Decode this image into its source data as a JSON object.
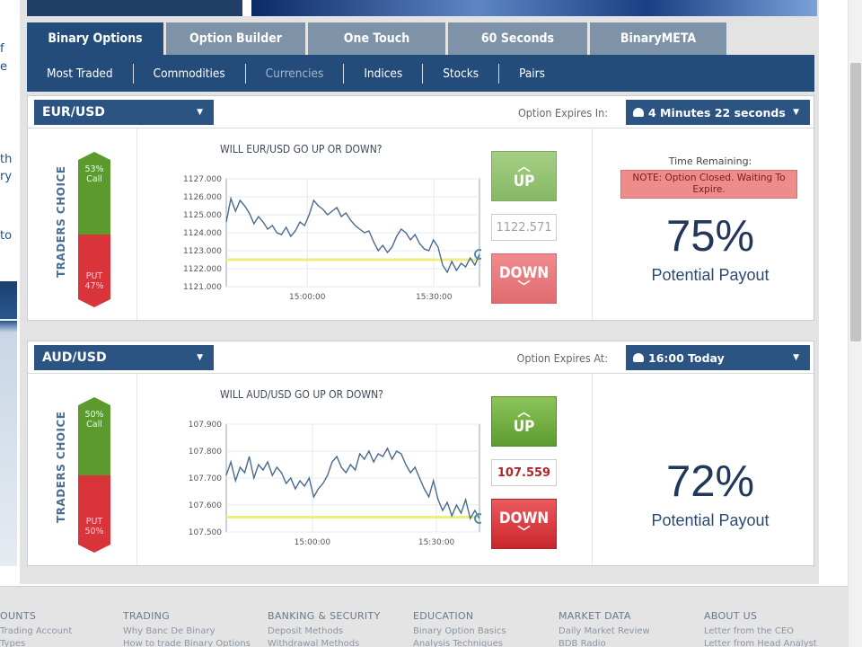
{
  "sidebar_fragments": [
    "f",
    "e",
    "th",
    "ry",
    "to"
  ],
  "tabs": [
    {
      "label": "Binary Options",
      "active": true
    },
    {
      "label": "Option Builder",
      "active": false
    },
    {
      "label": "One Touch",
      "active": false
    },
    {
      "label": "60 Seconds",
      "active": false
    },
    {
      "label": "BinaryMETA",
      "active": false
    }
  ],
  "subnav": [
    {
      "label": "Most Traded",
      "dim": false
    },
    {
      "label": "Commodities",
      "dim": false
    },
    {
      "label": "Currencies",
      "dim": true
    },
    {
      "label": "Indices",
      "dim": false
    },
    {
      "label": "Stocks",
      "dim": false
    },
    {
      "label": "Pairs",
      "dim": false
    }
  ],
  "options": [
    {
      "asset": "EUR/USD",
      "expiry_label": "Option Expires In:",
      "expiry_value": "4 Minutes 22 seconds",
      "traders_choice_label": "TRADERS CHOICE",
      "call_pct": "53%",
      "call_label": "Call",
      "put_label": "PUT",
      "put_pct": "47%",
      "call_fraction": 0.53,
      "chart_title": "WILL EUR/USD GO UP OR DOWN?",
      "up_label": "UP",
      "down_label": "DOWN",
      "rate": "1122.571",
      "rate_color": "#9aa4ae",
      "buttons_faded": true,
      "time_remaining_label": "Time Remaining:",
      "note": "NOTE: Option Closed. Waiting To Expire.",
      "payout_pct": "75%",
      "payout_label": "Potential Payout"
    },
    {
      "asset": "AUD/USD",
      "expiry_label": "Option Expires At:",
      "expiry_value": "16:00 Today",
      "traders_choice_label": "TRADERS CHOICE",
      "call_pct": "50%",
      "call_label": "Call",
      "put_label": "PUT",
      "put_pct": "50%",
      "call_fraction": 0.5,
      "chart_title": "WILL AUD/USD GO UP OR DOWN?",
      "up_label": "UP",
      "down_label": "DOWN",
      "rate": "107.559",
      "rate_color": "#b0252a",
      "buttons_faded": false,
      "time_remaining_label": "",
      "note": "",
      "payout_pct": "72%",
      "payout_label": "Potential Payout"
    }
  ],
  "chart_data": [
    {
      "type": "line",
      "yticks": [
        "1127.000",
        "1126.000",
        "1125.000",
        "1124.000",
        "1123.000",
        "1122.000",
        "1121.000"
      ],
      "ylim": [
        1121,
        1127
      ],
      "xticks": [
        "15:00:00",
        "15:30:00"
      ],
      "xtick_positions": [
        0.32,
        0.82
      ],
      "strike_line": 1122.5,
      "values": [
        1124.6,
        1125.9,
        1125.2,
        1125.8,
        1125.5,
        1125.1,
        1124.5,
        1124.9,
        1124.6,
        1124.2,
        1124.4,
        1124.0,
        1123.9,
        1124.3,
        1123.8,
        1124.1,
        1124.6,
        1124.4,
        1125.0,
        1125.8,
        1125.5,
        1125.3,
        1125.0,
        1125.2,
        1125.4,
        1124.9,
        1125.1,
        1124.7,
        1124.4,
        1124.2,
        1124.0,
        1124.1,
        1123.5,
        1123.0,
        1123.3,
        1122.9,
        1123.2,
        1123.8,
        1124.2,
        1124.0,
        1123.6,
        1123.9,
        1123.4,
        1123.1,
        1123.0,
        1123.6,
        1123.2,
        1122.2,
        1121.8,
        1122.4,
        1121.9,
        1122.3,
        1122.1,
        1122.6,
        1122.2,
        1122.8
      ]
    },
    {
      "type": "line",
      "yticks": [
        "107.900",
        "107.800",
        "107.700",
        "107.600",
        "107.500"
      ],
      "ylim": [
        107.5,
        107.9
      ],
      "xticks": [
        "15:00:00",
        "15:30:00"
      ],
      "xtick_positions": [
        0.34,
        0.83
      ],
      "strike_line": 107.555,
      "values": [
        107.71,
        107.76,
        107.69,
        107.74,
        107.72,
        107.78,
        107.7,
        107.75,
        107.73,
        107.76,
        107.71,
        107.74,
        107.72,
        107.68,
        107.7,
        107.66,
        107.69,
        107.67,
        107.7,
        107.63,
        107.66,
        107.68,
        107.71,
        107.76,
        107.78,
        107.74,
        107.72,
        107.75,
        107.73,
        107.79,
        107.77,
        107.8,
        107.76,
        107.79,
        107.78,
        107.81,
        107.77,
        107.8,
        107.79,
        107.75,
        107.72,
        107.74,
        107.7,
        107.66,
        107.63,
        107.69,
        107.62,
        107.58,
        107.61,
        107.56,
        107.6,
        107.57,
        107.62,
        107.55,
        107.58,
        107.55
      ]
    }
  ],
  "footer": {
    "columns": [
      {
        "heading": "OUNTS",
        "links": [
          "Trading Account",
          "Types"
        ]
      },
      {
        "heading": "TRADING",
        "links": [
          "Why Banc De Binary",
          "How to trade Binary Options"
        ]
      },
      {
        "heading": "BANKING & SECURITY",
        "links": [
          "Deposit Methods",
          "Withdrawal Methods"
        ]
      },
      {
        "heading": "EDUCATION",
        "links": [
          "Binary Option Basics",
          "Analysis Techniques"
        ]
      },
      {
        "heading": "MARKET DATA",
        "links": [
          "Daily Market Review",
          "BDB Radio"
        ]
      },
      {
        "heading": "ABOUT US",
        "links": [
          "Letter from the CEO",
          "Letter from Head Analyst"
        ]
      }
    ]
  }
}
